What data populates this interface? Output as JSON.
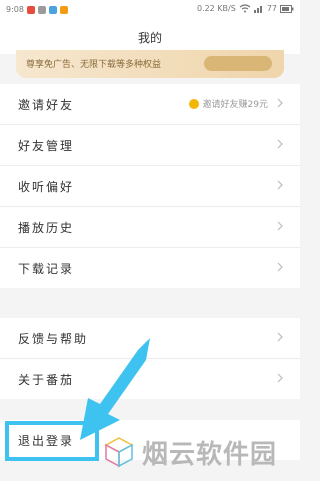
{
  "status": {
    "time": "9:08",
    "network_speed": "0.22 KB/S",
    "battery": "77"
  },
  "header": {
    "title": "我的"
  },
  "banner": {
    "text": "尊享免广告、无限下载等多种权益"
  },
  "menu": [
    {
      "label": "邀请好友",
      "extra": "邀请好友赚29元"
    },
    {
      "label": "好友管理"
    },
    {
      "label": "收听偏好"
    },
    {
      "label": "播放历史"
    },
    {
      "label": "下载记录"
    }
  ],
  "menu2": [
    {
      "label": "反馈与帮助"
    },
    {
      "label": "关于番茄"
    }
  ],
  "logout": {
    "label": "退出登录"
  },
  "watermark": {
    "text": "烟云软件园"
  },
  "colors": {
    "accent_arrow": "#3ec3f0",
    "banner_gold": "#efd5ab",
    "coin": "#f2b705"
  }
}
